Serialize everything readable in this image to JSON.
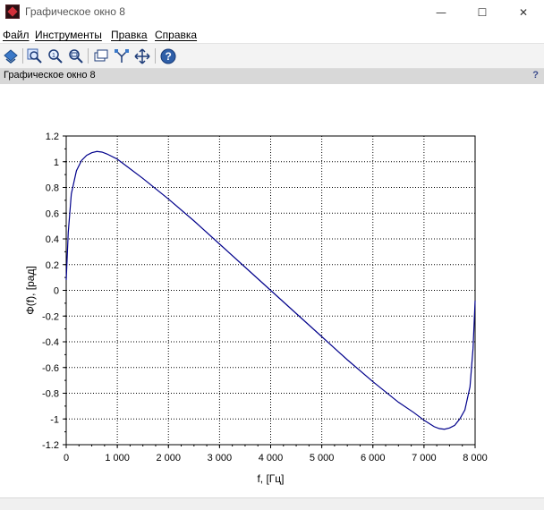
{
  "window": {
    "title": "Графическое окно 8",
    "controls": {
      "minimize": "—",
      "maximize": "☐",
      "close": "✕"
    }
  },
  "menubar": {
    "items": [
      {
        "label": "Файл"
      },
      {
        "label": "Инструменты"
      },
      {
        "label": "Правка"
      },
      {
        "label": "Справка"
      }
    ]
  },
  "toolbar": {
    "buttons": [
      "rotate-icon",
      "zoom-area-icon",
      "zoom-icon",
      "zoom-fit-icon",
      "datatip-icon",
      "graph-icon",
      "pan-icon",
      "help-icon"
    ]
  },
  "figure_strip": {
    "title": "Графическое окно 8",
    "help": "?"
  },
  "colors": {
    "curve": "#00008b",
    "grid": "#000000",
    "toolbar_bg": "#f3f3f3",
    "strip_bg": "#d8d8d8"
  },
  "chart_data": {
    "type": "line",
    "xlabel": "f, [Гц]",
    "ylabel": "Φ(f), [рад]",
    "xlim": [
      0,
      8000
    ],
    "ylim": [
      -1.2,
      1.2
    ],
    "grid": true,
    "x_ticks": [
      0,
      1000,
      2000,
      3000,
      4000,
      5000,
      6000,
      7000,
      8000
    ],
    "x_tick_labels": [
      "0",
      "1 000",
      "2 000",
      "3 000",
      "4 000",
      "5 000",
      "6 000",
      "7 000",
      "8 000"
    ],
    "y_ticks": [
      1.2,
      1,
      0.8,
      0.6,
      0.4,
      0.2,
      0,
      -0.2,
      -0.4,
      -0.6,
      -0.8,
      -1,
      -1.2
    ],
    "y_tick_labels": [
      "1.2",
      "1",
      "0.8",
      "0.6",
      "0.4",
      "0.2",
      "0",
      "-0.2",
      "-0.4",
      "-0.6",
      "-0.8",
      "-1",
      "-1.2"
    ],
    "series": [
      {
        "x": [
          0,
          40,
          100,
          200,
          300,
          400,
          500,
          600,
          700,
          800,
          1000,
          1200,
          1500,
          2000,
          2500,
          3000,
          3500,
          4000,
          4500,
          5000,
          5500,
          6000,
          6500,
          6800,
          7000,
          7200,
          7300,
          7400,
          7500,
          7600,
          7700,
          7800,
          7900,
          7960,
          8000
        ],
        "y": [
          0.08,
          0.45,
          0.75,
          0.93,
          1.01,
          1.05,
          1.07,
          1.08,
          1.075,
          1.06,
          1.02,
          0.96,
          0.87,
          0.71,
          0.54,
          0.36,
          0.18,
          0.0,
          -0.18,
          -0.36,
          -0.54,
          -0.71,
          -0.87,
          -0.95,
          -1.01,
          -1.06,
          -1.075,
          -1.08,
          -1.07,
          -1.05,
          -1.0,
          -0.93,
          -0.75,
          -0.45,
          -0.08
        ]
      }
    ]
  }
}
